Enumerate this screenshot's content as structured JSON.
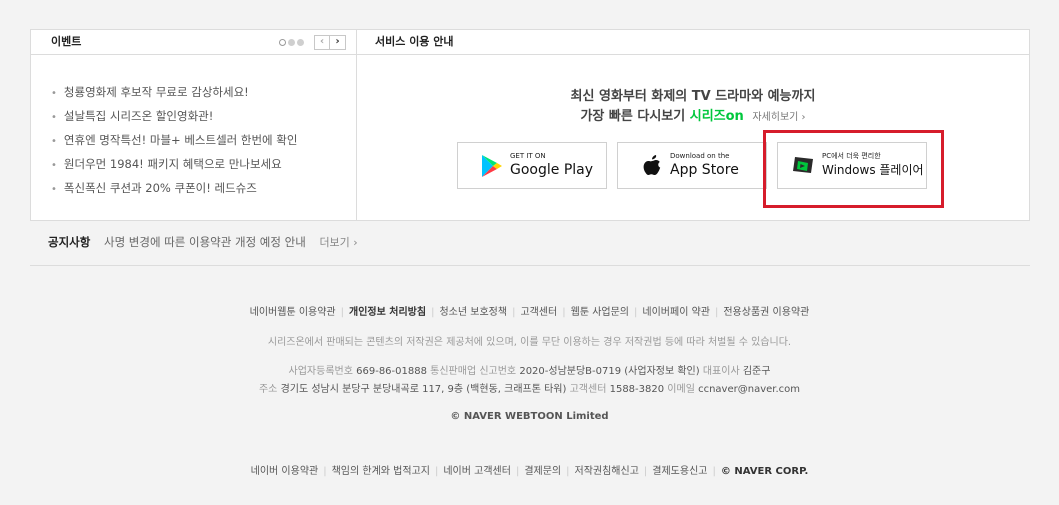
{
  "event": {
    "title": "이벤트",
    "prev_label": "‹",
    "next_label": "›",
    "items": [
      "청룡영화제 후보작 무료로 감상하세요!",
      "설날특집 시리즈온 할인영화관!",
      "연휴엔 명작특선! 마블+ 베스트셀러 한번에 확인",
      "원더우먼 1984! 패키지 혜택으로 만나보세요",
      "폭신폭신 쿠션과 20% 쿠폰이! 레드슈즈"
    ]
  },
  "service": {
    "title": "서비스 이용 안내",
    "line1": "최신 영화부터 화제의 TV 드라마와 예능까지",
    "line2_prefix": "가장 빠른 다시보기",
    "brand": "시리즈on",
    "more": "자세히보기 ›",
    "buttons": {
      "google_small": "GET IT ON",
      "google_big": "Google Play",
      "apple_small": "Download on the",
      "apple_big": "App Store",
      "win_small": "PC에서 더욱 편리한",
      "win_big": "Windows 플레이어"
    },
    "colors": {
      "brand": "#00c73c",
      "highlight": "#d61c2b"
    }
  },
  "notice": {
    "title": "공지사항",
    "text": "사명 변경에 따른 이용약관 개정 예정 안내",
    "more": "더보기 ›"
  },
  "footer": {
    "links1": [
      "네이버웹툰 이용약관",
      "개인정보 처리방침",
      "청소년 보호정책",
      "고객센터",
      "웹툰 사업문의",
      "네이버페이 약관",
      "전용상품권 이용약관"
    ],
    "disclaimer": "시리즈온에서 판매되는 콘텐츠의 저작권은 제공처에 있으며, 이를 무단 이용하는 경우 저작권법 등에 따라 처벌될 수 있습니다.",
    "info1": {
      "reg_label": "사업자등록번호",
      "reg": "669-86-01888",
      "sales_label": "통신판매업 신고번호",
      "sales": "2020-성남분당B-0719 (사업자정보 확인)",
      "ceo_label": "대표이사",
      "ceo": "김준구"
    },
    "info2": {
      "addr_label": "주소",
      "addr": "경기도 성남시 분당구 분당내곡로 117, 9층 (백현동, 크래프톤 타워)",
      "cs_label": "고객센터",
      "cs": "1588-3820",
      "email_label": "이메일",
      "email": "ccnaver@naver.com"
    },
    "copyright": "© NAVER WEBTOON Limited",
    "links2": [
      "네이버 이용약관",
      "책임의 한계와 법적고지",
      "네이버 고객센터",
      "결제문의",
      "저작권침해신고",
      "결제도용신고"
    ],
    "corp": "© NAVER CORP."
  }
}
